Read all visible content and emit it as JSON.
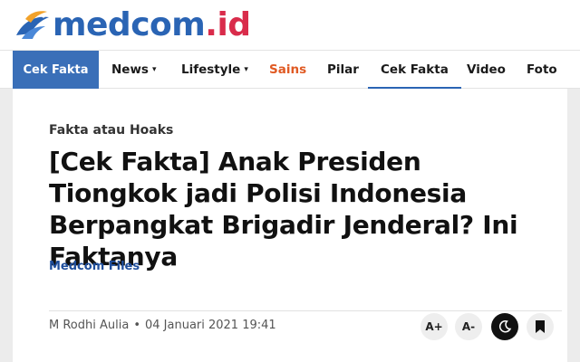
{
  "brand": {
    "name_main": "medcom",
    "name_ext": ".id"
  },
  "nav": {
    "active_section": "Cek Fakta",
    "items": [
      {
        "label": "News",
        "has_dropdown": true
      },
      {
        "label": "Lifestyle",
        "has_dropdown": true
      },
      {
        "label": "Sains",
        "has_dropdown": false
      },
      {
        "label": "Pilar",
        "has_dropdown": false
      },
      {
        "label": "Cek Fakta",
        "has_dropdown": false
      },
      {
        "label": "Video",
        "has_dropdown": false
      },
      {
        "label": "Foto",
        "has_dropdown": false
      }
    ],
    "caret": "▾"
  },
  "article": {
    "kicker": "Fakta atau Hoaks",
    "title": "[Cek Fakta] Anak Presiden Tiongkok jadi Polisi Indonesia Berpangkat Brigadir Jenderal? Ini Faktanya",
    "source": "Medcom Files",
    "author": "M Rodhi Aulia",
    "separator": "•",
    "date": "04 Januari 2021 19:41"
  },
  "tools": {
    "increase_font": "A+",
    "decrease_font": "A-",
    "dark_mode_icon": "moon-icon",
    "bookmark_icon": "bookmark-icon"
  },
  "colors": {
    "brand_blue": "#2a64b4",
    "brand_red": "#d92c4b",
    "nav_active_bg": "#3a6fb8",
    "highlight_orange": "#e05a23",
    "source_blue": "#1f4e9c"
  }
}
